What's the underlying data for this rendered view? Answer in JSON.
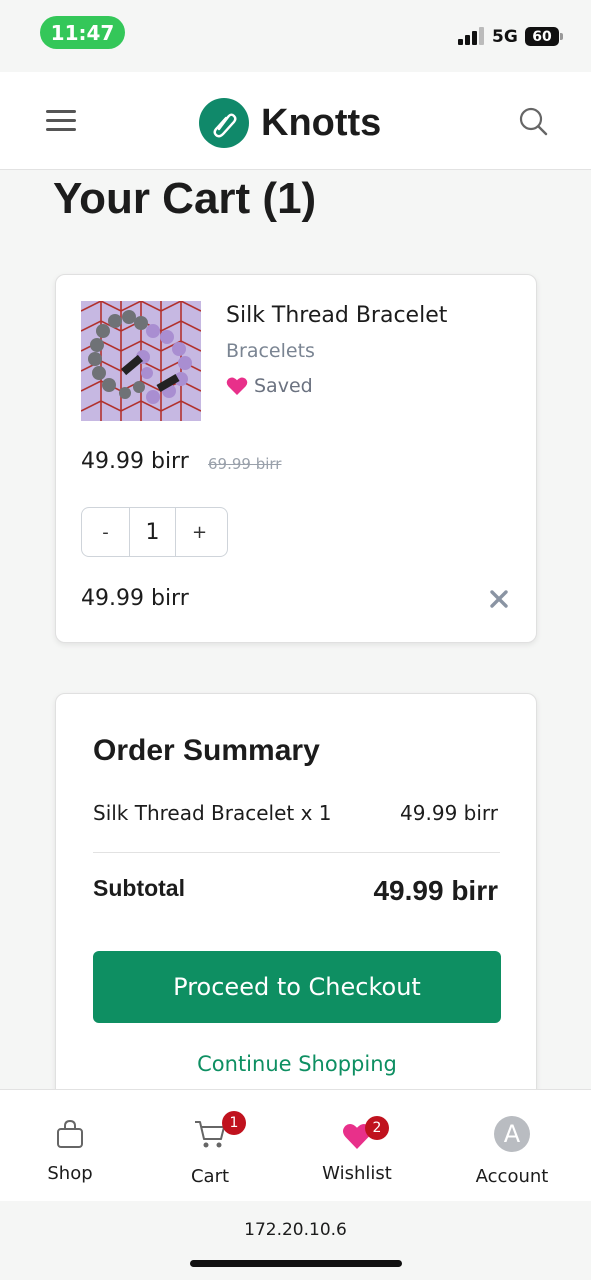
{
  "status_bar": {
    "time": "11:47",
    "network": "5G",
    "battery": "60"
  },
  "header": {
    "brand": "Knotts",
    "brand_color": "#10896a",
    "menu_icon": "hamburger-icon",
    "search_icon": "search-icon"
  },
  "page": {
    "title": "Your Cart (1)"
  },
  "cart_item": {
    "name": "Silk Thread Bracelet",
    "category": "Bracelets",
    "saved_label": "Saved",
    "saved_color": "#e8308a",
    "price": "49.99 birr",
    "original_price": "69.99 birr",
    "quantity": "1",
    "decrement_label": "-",
    "increment_label": "+",
    "line_total": "49.99 birr"
  },
  "summary": {
    "title": "Order Summary",
    "item_line": "Silk Thread Bracelet x 1",
    "item_price": "49.99 birr",
    "subtotal_label": "Subtotal",
    "subtotal_value": "49.99 birr",
    "checkout_label": "Proceed to Checkout",
    "continue_label": "Continue Shopping",
    "accent_color": "#0e8f62"
  },
  "bottom_nav": {
    "items": [
      {
        "label": "Shop",
        "icon": "shopping-bag-icon"
      },
      {
        "label": "Cart",
        "icon": "cart-icon",
        "badge": "1"
      },
      {
        "label": "Wishlist",
        "icon": "heart-icon",
        "badge": "2"
      },
      {
        "label": "Account",
        "icon": "avatar-icon",
        "avatar_letter": "A"
      }
    ]
  },
  "browser": {
    "url": "172.20.10.6"
  }
}
